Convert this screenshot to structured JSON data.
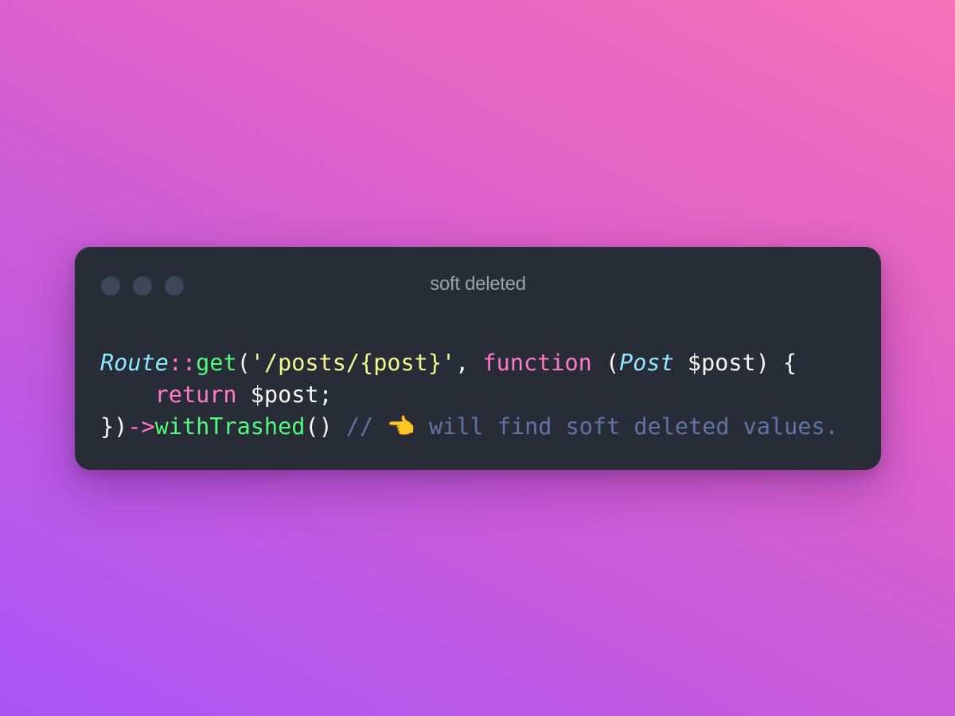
{
  "window": {
    "title": "soft deleted",
    "controls": [
      "close",
      "minimize",
      "maximize"
    ]
  },
  "code": {
    "language": "php",
    "lines": [
      [
        {
          "type": "class",
          "text": "Route"
        },
        {
          "type": "punc",
          "text": "::"
        },
        {
          "type": "func",
          "text": "get"
        },
        {
          "type": "text",
          "text": "("
        },
        {
          "type": "str",
          "text": "'/posts/{post}'"
        },
        {
          "type": "text",
          "text": ", "
        },
        {
          "type": "kw",
          "text": "function"
        },
        {
          "type": "text",
          "text": " ("
        },
        {
          "type": "class",
          "text": "Post"
        },
        {
          "type": "text",
          "text": " $post) {"
        }
      ],
      [
        {
          "type": "text",
          "text": "    "
        },
        {
          "type": "kw",
          "text": "return"
        },
        {
          "type": "text",
          "text": " $post;"
        }
      ],
      [
        {
          "type": "text",
          "text": "})"
        },
        {
          "type": "punc",
          "text": "->"
        },
        {
          "type": "func",
          "text": "withTrashed"
        },
        {
          "type": "text",
          "text": "() "
        },
        {
          "type": "comment",
          "text": "// "
        },
        {
          "type": "emoji",
          "text": "👈"
        },
        {
          "type": "comment",
          "text": " will find soft deleted values."
        }
      ]
    ]
  },
  "colors": {
    "window_bg": "#282c37",
    "class": "#8be9fd",
    "function": "#50fa7b",
    "string": "#f1fa8c",
    "keyword": "#ff79c6",
    "comment": "#6272a4"
  }
}
